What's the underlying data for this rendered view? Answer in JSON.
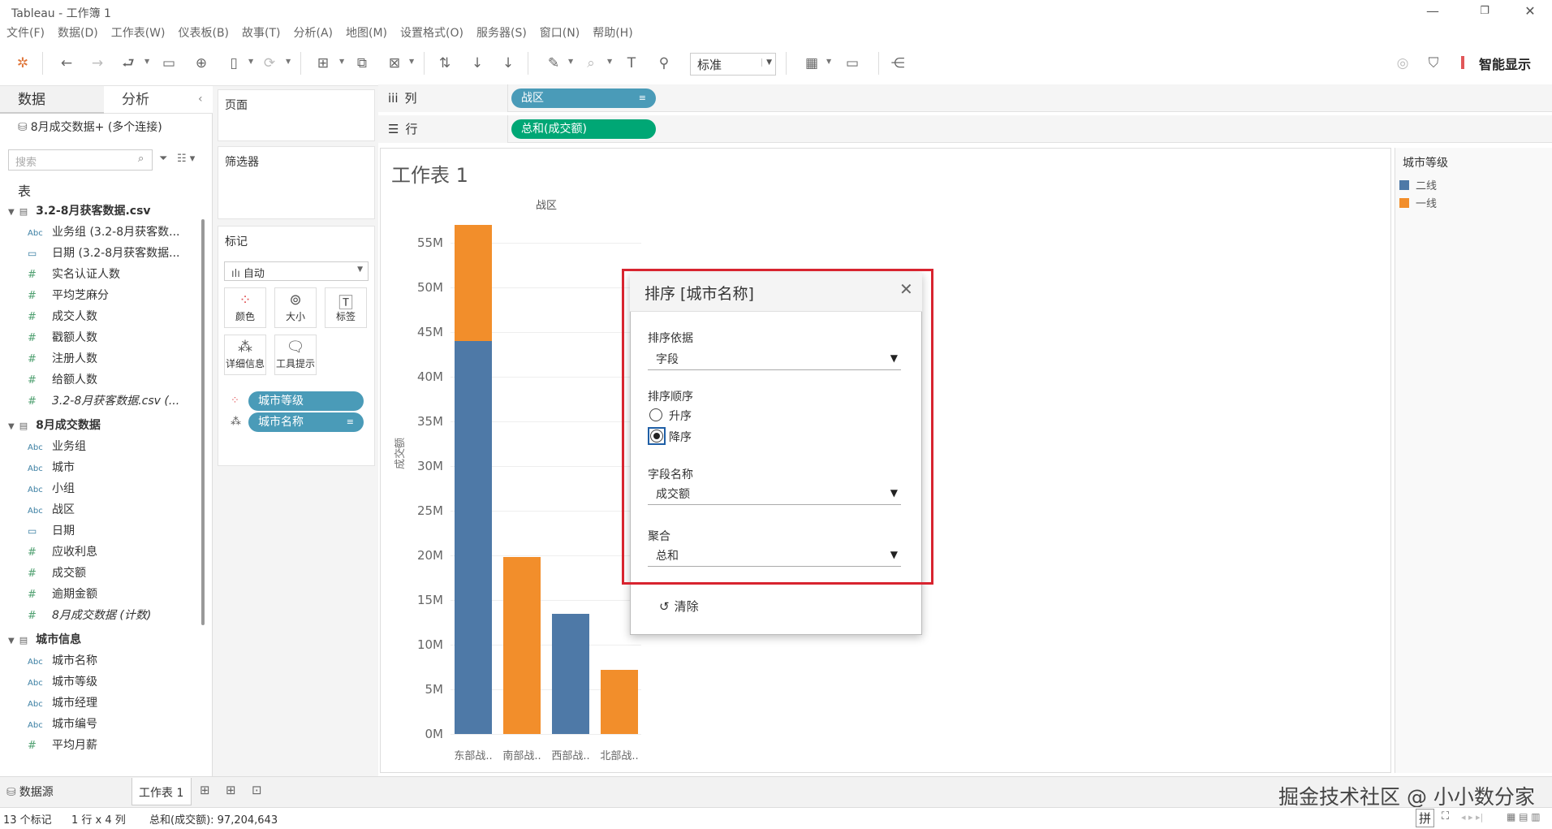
{
  "window": {
    "title": "Tableau - 工作簿 1"
  },
  "menu": [
    "文件(F)",
    "数据(D)",
    "工作表(W)",
    "仪表板(B)",
    "故事(T)",
    "分析(A)",
    "地图(M)",
    "设置格式(O)",
    "服务器(S)",
    "窗口(N)",
    "帮助(H)"
  ],
  "toolbar": {
    "zoom": "标准",
    "show_me": "智能显示"
  },
  "left": {
    "tab_data": "数据",
    "tab_analysis": "分析",
    "connection": "8月成交数据+ (多个连接)",
    "search_placeholder": "搜索",
    "tables_label": "表",
    "groups": [
      {
        "name": "3.2-8月获客数据.csv",
        "fields": [
          {
            "type": "abc",
            "name": "业务组 (3.2-8月获客数..."
          },
          {
            "type": "date",
            "name": "日期 (3.2-8月获客数据..."
          },
          {
            "type": "num",
            "name": "实名认证人数"
          },
          {
            "type": "num",
            "name": "平均芝麻分"
          },
          {
            "type": "num",
            "name": "成交人数"
          },
          {
            "type": "num",
            "name": "戳额人数"
          },
          {
            "type": "num",
            "name": "注册人数"
          },
          {
            "type": "num",
            "name": "给额人数"
          },
          {
            "type": "num",
            "name": "3.2-8月获客数据.csv (..."
          }
        ]
      },
      {
        "name": "8月成交数据",
        "fields": [
          {
            "type": "abc",
            "name": "业务组"
          },
          {
            "type": "abc",
            "name": "城市"
          },
          {
            "type": "abc",
            "name": "小组"
          },
          {
            "type": "abc",
            "name": "战区"
          },
          {
            "type": "date",
            "name": "日期"
          },
          {
            "type": "num",
            "name": "应收利息"
          },
          {
            "type": "num",
            "name": "成交额"
          },
          {
            "type": "num",
            "name": "逾期金额"
          },
          {
            "type": "num",
            "name": "8月成交数据 (计数)"
          }
        ]
      },
      {
        "name": "城市信息",
        "fields": [
          {
            "type": "abc",
            "name": "城市名称"
          },
          {
            "type": "abc",
            "name": "城市等级"
          },
          {
            "type": "abc",
            "name": "城市经理"
          },
          {
            "type": "abc",
            "name": "城市编号"
          },
          {
            "type": "num",
            "name": "平均月薪"
          }
        ]
      }
    ]
  },
  "cards": {
    "pages": "页面",
    "filters": "筛选器",
    "marks": "标记",
    "marks_type": "自动",
    "buttons": [
      "颜色",
      "大小",
      "标签",
      "详细信息",
      "工具提示"
    ],
    "pill_color": "城市等级",
    "pill_detail": "城市名称"
  },
  "shelves": {
    "columns_label": "列",
    "columns_pill": "战区",
    "rows_label": "行",
    "rows_pill": "总和(成交额)"
  },
  "sheet": {
    "title": "工作表 1",
    "col_header": "战区",
    "ylabel": "成交额"
  },
  "chart_data": {
    "type": "bar",
    "stacked": true,
    "categories": [
      "东部战..",
      "南部战..",
      "西部战..",
      "北部战.."
    ],
    "series": [
      {
        "name": "二线",
        "color": "#4e79a7",
        "values": [
          44000000,
          0,
          13500000,
          0
        ]
      },
      {
        "name": "一线",
        "color": "#f28e2b",
        "values": [
          13000000,
          19800000,
          0,
          7200000
        ]
      }
    ],
    "yticks": [
      "0M",
      "5M",
      "10M",
      "15M",
      "20M",
      "25M",
      "30M",
      "35M",
      "40M",
      "45M",
      "50M",
      "55M"
    ],
    "ylim": [
      0,
      60000000
    ]
  },
  "legend": {
    "title": "城市等级",
    "items": [
      {
        "label": "二线",
        "color": "#4e79a7"
      },
      {
        "label": "一线",
        "color": "#f28e2b"
      }
    ]
  },
  "dialog": {
    "title": "排序 [城市名称]",
    "sort_by_label": "排序依据",
    "sort_by": "字段",
    "order_label": "排序顺序",
    "asc": "升序",
    "desc": "降序",
    "field_label": "字段名称",
    "field": "成交额",
    "agg_label": "聚合",
    "agg": "总和",
    "clear": "清除"
  },
  "bottom": {
    "datasource": "数据源",
    "sheet_tab": "工作表 1",
    "watermark": "掘金技术社区 @ 小小数分家"
  },
  "status": {
    "marks": "13 个标记",
    "dims": "1 行 x 4 列",
    "sum": "总和(成交额): 97,204,643"
  }
}
